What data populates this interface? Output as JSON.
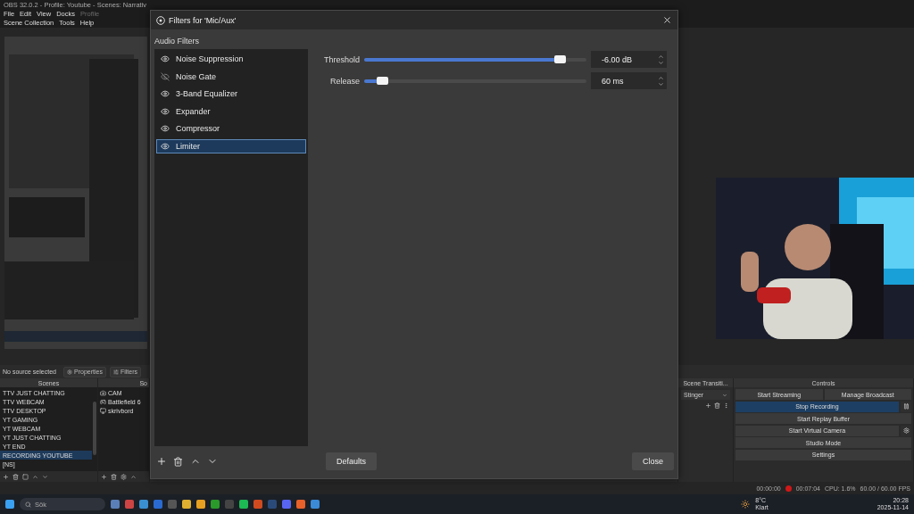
{
  "main_window": {
    "title": "OBS 32.0.2 - Profile: Youtube - Scenes: Narrativ"
  },
  "menu": [
    {
      "label": "File",
      "disabled": false
    },
    {
      "label": "Edit",
      "disabled": false
    },
    {
      "label": "View",
      "disabled": false
    },
    {
      "label": "Docks",
      "disabled": false
    },
    {
      "label": "Profile",
      "disabled": true
    },
    {
      "label": "Scene Collection",
      "disabled": false
    },
    {
      "label": "Tools",
      "disabled": false
    },
    {
      "label": "Help",
      "disabled": false
    }
  ],
  "context_bar": {
    "status": "No source selected",
    "buttons": [
      "Properties",
      "Filters"
    ]
  },
  "scenes": {
    "title": "Scenes",
    "items": [
      {
        "label": "TTV JUST CHATTING",
        "selected": false
      },
      {
        "label": "TTV WEBCAM",
        "selected": false
      },
      {
        "label": "TTV DESKTOP",
        "selected": false
      },
      {
        "label": "YT GAMING",
        "selected": false
      },
      {
        "label": "YT WEBCAM",
        "selected": false
      },
      {
        "label": "YT JUST CHATTING",
        "selected": false
      },
      {
        "label": "YT END",
        "selected": false
      },
      {
        "label": "RECORDING YOUTUBE",
        "selected": true
      },
      {
        "label": "[NS]",
        "selected": false
      }
    ]
  },
  "sources": {
    "title": "So",
    "items": [
      {
        "label": "CAM",
        "kind": "camera"
      },
      {
        "label": "Battlefield 6",
        "kind": "game"
      },
      {
        "label": "skrivbord",
        "kind": "display"
      }
    ]
  },
  "transitions": {
    "title": "Scene Transiti...",
    "transition": "Stinger"
  },
  "controls": {
    "title": "Controls",
    "rows": [
      [
        {
          "label": "Start Streaming",
          "active": false,
          "kind": "plain"
        },
        {
          "label": "Manage Broadcast",
          "active": false,
          "kind": "plain"
        }
      ],
      [
        {
          "label": "Stop Recording",
          "active": true,
          "kind": "pause"
        }
      ],
      [
        {
          "label": "Start Replay Buffer",
          "active": false,
          "kind": "plain"
        }
      ],
      [
        {
          "label": "Start Virtual Camera",
          "active": false,
          "kind": "gear"
        }
      ],
      [
        {
          "label": "Studio Mode",
          "active": false,
          "kind": "plain"
        }
      ],
      [
        {
          "label": "Settings",
          "active": false,
          "kind": "plain"
        }
      ]
    ]
  },
  "status_bar": {
    "stream_time": "00:00:00",
    "record_time": "00:07:04",
    "cpu": "CPU: 1.6%",
    "fps": "60.00 / 60.00 FPS"
  },
  "dialog": {
    "title": "Filters for 'Mic/Aux'",
    "section": "Audio Filters",
    "filters": [
      {
        "label": "Noise Suppression",
        "enabled": true,
        "selected": false
      },
      {
        "label": "Noise Gate",
        "enabled": false,
        "selected": false
      },
      {
        "label": "3-Band Equalizer",
        "enabled": true,
        "selected": false
      },
      {
        "label": "Expander",
        "enabled": true,
        "selected": false
      },
      {
        "label": "Compressor",
        "enabled": true,
        "selected": false
      },
      {
        "label": "Limiter",
        "enabled": true,
        "selected": true
      }
    ],
    "settings": [
      {
        "label": "Threshold",
        "level": 0.88,
        "value": "-6.00 dB"
      },
      {
        "label": "Release",
        "level": 0.08,
        "value": "60 ms"
      }
    ],
    "defaults_button": "Defaults",
    "close_button": "Close"
  },
  "taskbar": {
    "search_placeholder": "Sök",
    "weather_temp": "8°C",
    "weather_text": "Klart",
    "time": "20:28",
    "date": "2025-11-14"
  }
}
